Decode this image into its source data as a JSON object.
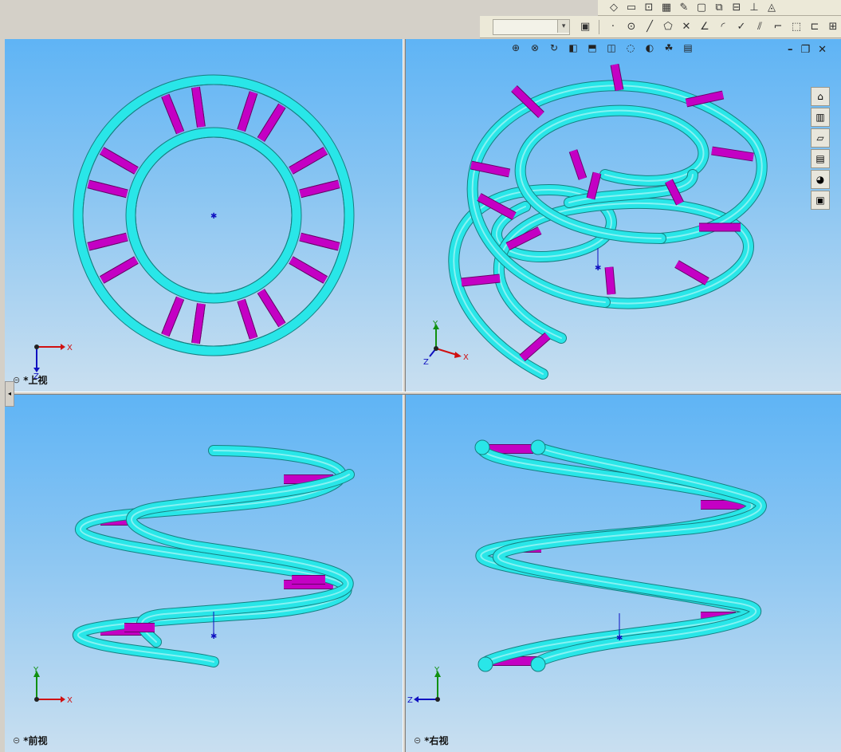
{
  "viewports": {
    "top": {
      "label": "*上视",
      "axes": [
        "X",
        "Z"
      ]
    },
    "isometric": {
      "axes": [
        "Y",
        "X",
        "Z"
      ]
    },
    "front": {
      "label": "*前视",
      "axes": [
        "Y",
        "X"
      ]
    },
    "right": {
      "label": "*右视",
      "axes": [
        "Y",
        "Z"
      ]
    }
  },
  "toolbar": {
    "top_icons": [
      "smart-dimension-icon",
      "rectangle-icon",
      "sketch-icon",
      "table-icon",
      "edit-icon",
      "window-icon",
      "copy-icon",
      "mirror-icon",
      "base-icon",
      "surface-icon"
    ],
    "sketch_icons": [
      "point-icon",
      "circle-icon",
      "line-icon",
      "polygon-icon",
      "trim-icon",
      "angle-icon",
      "fillet-icon",
      "check-icon",
      "offset-icon",
      "corner-icon",
      "convert-icon",
      "box-icon",
      "grid-icon"
    ]
  },
  "viewport_tools": [
    "zoom-fit-icon",
    "zoom-area-icon",
    "rotate-icon",
    "section-icon",
    "view-orientation-icon",
    "display-style-icon",
    "hide-show-icon",
    "appearance-icon",
    "scene-icon",
    "view-settings-icon"
  ],
  "window_controls": {
    "minimize": "–",
    "restore": "❐",
    "close": "✕"
  },
  "task_pane": [
    "home-icon",
    "design-library-icon",
    "file-explorer-icon",
    "view-palette-icon",
    "appearances-icon",
    "custom-properties-icon"
  ],
  "colors": {
    "tube": "#29e6e8",
    "tube_edge": "#167f80",
    "rod": "#c400c4",
    "rod_edge": "#6a006a",
    "axis_x": "#d01010",
    "axis_y": "#109010",
    "axis_z": "#1010c0"
  }
}
